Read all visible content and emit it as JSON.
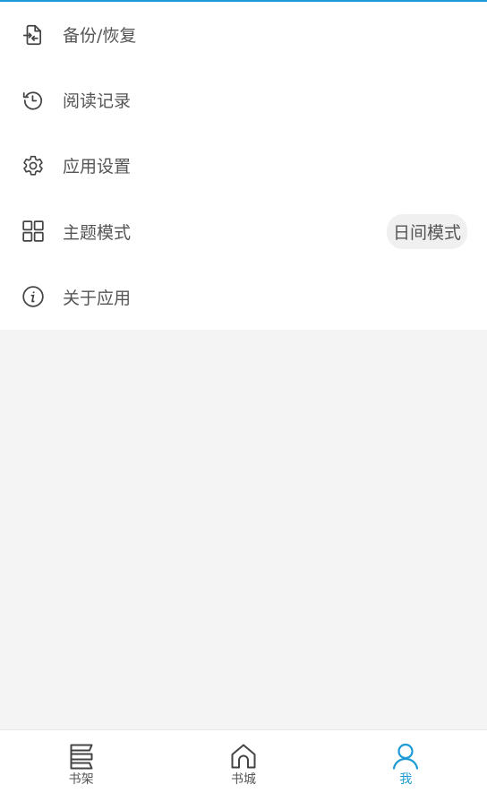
{
  "menu": {
    "items": [
      {
        "label": "备份/恢复",
        "icon": "backup-restore-icon"
      },
      {
        "label": "阅读记录",
        "icon": "history-icon"
      },
      {
        "label": "应用设置",
        "icon": "gear-icon"
      },
      {
        "label": "主题模式",
        "icon": "grid-icon",
        "value": "日间模式"
      },
      {
        "label": "关于应用",
        "icon": "info-icon"
      }
    ]
  },
  "bottom_nav": {
    "tabs": [
      {
        "label": "书架",
        "icon": "bookshelf-icon"
      },
      {
        "label": "书城",
        "icon": "home-icon"
      },
      {
        "label": "我",
        "icon": "user-icon",
        "active": true
      }
    ]
  },
  "colors": {
    "accent": "#1e9bd7",
    "icon": "#444444",
    "text": "#555555",
    "background": "#f4f4f4"
  }
}
